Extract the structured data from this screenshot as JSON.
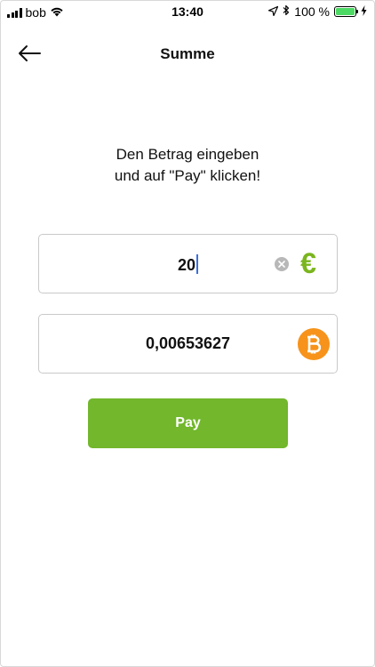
{
  "status_bar": {
    "carrier": "bob",
    "time": "13:40",
    "battery": "100 %",
    "battery_level": 1.0
  },
  "nav": {
    "title": "Summe",
    "back_icon": "arrow-left-icon"
  },
  "instructions": {
    "line1": "Den Betrag eingeben",
    "line2": "und auf \"Pay\" klicken!"
  },
  "fiat_field": {
    "value": "20",
    "currency_symbol": "€",
    "clear_icon": "clear-icon",
    "accent_color": "#7ab51d"
  },
  "crypto_field": {
    "value": "0,00653627",
    "currency_icon": "bitcoin-icon",
    "accent_color": "#f7931a"
  },
  "pay_button": {
    "label": "Pay",
    "color": "#72b72c"
  }
}
